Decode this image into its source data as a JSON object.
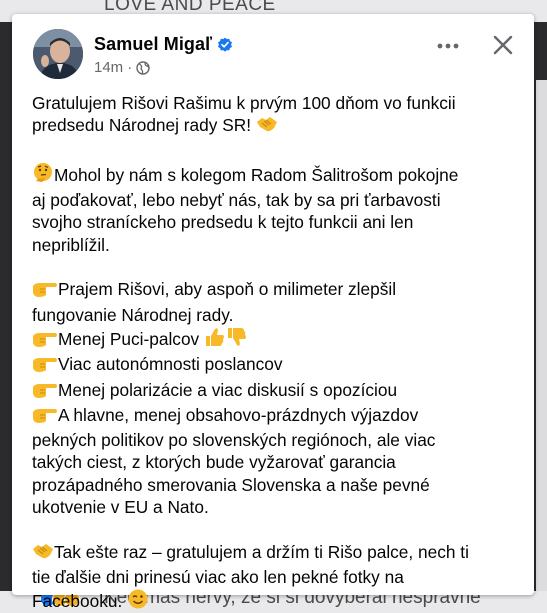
{
  "background": {
    "top_text": "LOVE AND PEACE",
    "bottom_text": "Keď máš nervy, že si si dovyberal nesprávne"
  },
  "post": {
    "author": "Samuel Migaľ",
    "time": "14m",
    "dot": "·",
    "icons": {
      "verified": "verified-badge-icon",
      "audience": "globe-icon",
      "more": "more-horizontal-icon",
      "close": "close-icon"
    },
    "colors": {
      "accent": "#1877f2",
      "text": "#050505",
      "meta": "#65676b",
      "emoji_yellow": "#f7b928"
    },
    "paragraphs": [
      {
        "lines": [
          {
            "text": "Gratulujem Rišovi Rašimu k prvým 100 dňom vo funkcii"
          },
          {
            "text": "predsedu Národnej rady SR!",
            "emoji_after": "handshake"
          }
        ]
      },
      {
        "lines": [
          {
            "emoji_before": "thinking",
            "text": "Mohol by nám s kolegom Radom Šalitrošom pokojne"
          },
          {
            "text": "aj poďakovať, lebo nebyť nás, tak by sa pri ťarbavosti"
          },
          {
            "text": "svojho straníckeho predsedu k tejto funkcii ani len"
          },
          {
            "text": "nepriblížil."
          }
        ]
      },
      {
        "lines": [
          {
            "emoji_before": "point-right",
            "text": "Prajem Rišovi, aby aspoň o milimeter zlepšil"
          },
          {
            "text": "fungovanie Národnej rady."
          },
          {
            "emoji_before": "point-right",
            "text": "Menej Puci-palcov",
            "emoji_after": "thumbs"
          },
          {
            "emoji_before": "point-right",
            "text": "Viac autonómnosti poslancov"
          },
          {
            "emoji_before": "point-right",
            "text": "Menej polarizácie a viac diskusií s opozíciou"
          },
          {
            "emoji_before": "point-right",
            "text": "A hlavne, menej obsahovo-prázdnych výjazdov"
          },
          {
            "text": "pekných politikov po slovenských regiónoch, ale viac"
          },
          {
            "text": "takých ciest, z ktorých bude vyžarovať garancia"
          },
          {
            "text": "prozápadného smerovania Slovenska a naše pevné"
          },
          {
            "text": "ukotvenie v EU a Nato."
          }
        ]
      },
      {
        "lines": [
          {
            "emoji_before": "handshake",
            "text": "Tak ešte raz – gratulujem a držím ti Rišo palce, nech ti"
          },
          {
            "text": "tie ďalšie dni prinesú viac ako len pekné fotky na"
          },
          {
            "text": "Facebooku.",
            "emoji_after": "wink"
          }
        ]
      }
    ]
  }
}
